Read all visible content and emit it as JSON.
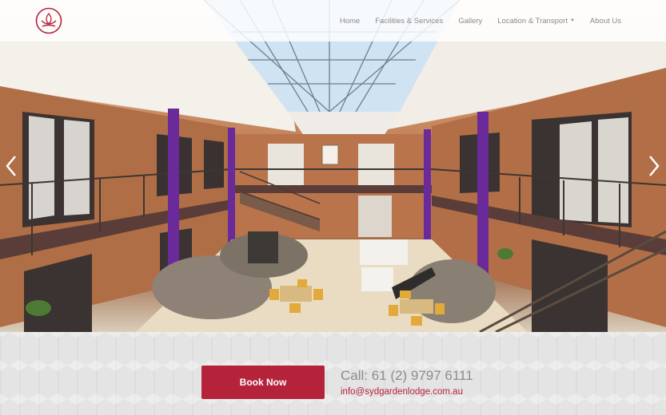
{
  "nav": {
    "items": [
      {
        "label": "Home",
        "dropdown": false
      },
      {
        "label": "Facilities & Services",
        "dropdown": false
      },
      {
        "label": "Gallery",
        "dropdown": false
      },
      {
        "label": "Location & Transport",
        "dropdown": true
      },
      {
        "label": "About Us",
        "dropdown": false
      }
    ]
  },
  "hero": {
    "image_icon": "hotel-atrium-photo"
  },
  "carousel": {
    "prev_icon": "chevron-left-icon",
    "next_icon": "chevron-right-icon"
  },
  "footer": {
    "book_label": "Book Now",
    "call_text": "Call: 61 (2) 9797 6111",
    "email_text": "info@sydgardenlodge.com.au"
  },
  "colors": {
    "brand": "#b5233b",
    "nav_text": "#8a8a8a",
    "pillar": "#6b2a9a"
  }
}
